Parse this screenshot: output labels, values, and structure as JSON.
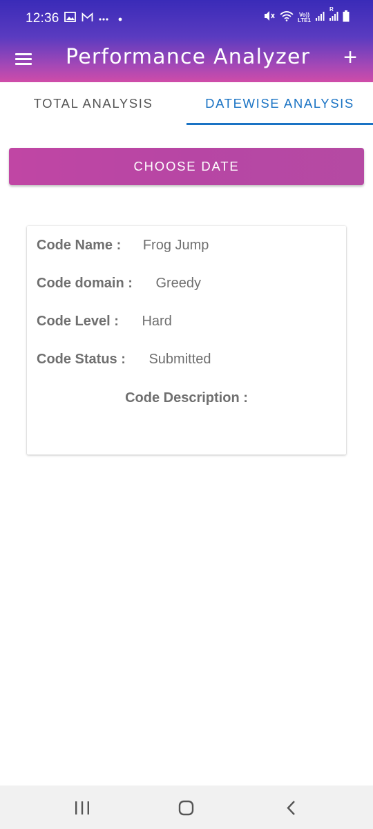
{
  "status_bar": {
    "time": "12:36",
    "left_icons": [
      "image-icon",
      "gmail-icon",
      "more-dots-icon",
      "dot-icon"
    ],
    "right_icons": [
      "mute-icon",
      "wifi-icon",
      "volte-icon",
      "signal-icon",
      "signal-icon",
      "battery-icon"
    ],
    "volte_text_top": "Vo))",
    "volte_text_bottom": "LTE1",
    "roaming_mark": "R"
  },
  "app_bar": {
    "title": "Performance Analyzer",
    "menu_icon": "hamburger-menu-icon",
    "add_icon": "plus-icon",
    "add_glyph": "+"
  },
  "tabs": [
    {
      "label": "TOTAL ANALYSIS",
      "selected": false
    },
    {
      "label": "DATEWISE ANALYSIS",
      "selected": true
    }
  ],
  "choose_date_button": {
    "label": "CHOOSE DATE"
  },
  "code_card": {
    "name_label": "Code Name :",
    "name_value": "Frog Jump",
    "domain_label": "Code domain :",
    "domain_value": "Greedy",
    "level_label": "Code Level :",
    "level_value": "Hard",
    "status_label": "Code Status :",
    "status_value": "Submitted",
    "description_label": "Code Description :"
  },
  "nav_bar": {
    "buttons": [
      "recent-apps-icon",
      "home-icon",
      "back-icon"
    ]
  },
  "colors": {
    "accent_tab": "#1a73c4",
    "button": "#b946a4",
    "header_top": "#3a2bb8",
    "header_bottom": "#d04ca8"
  }
}
